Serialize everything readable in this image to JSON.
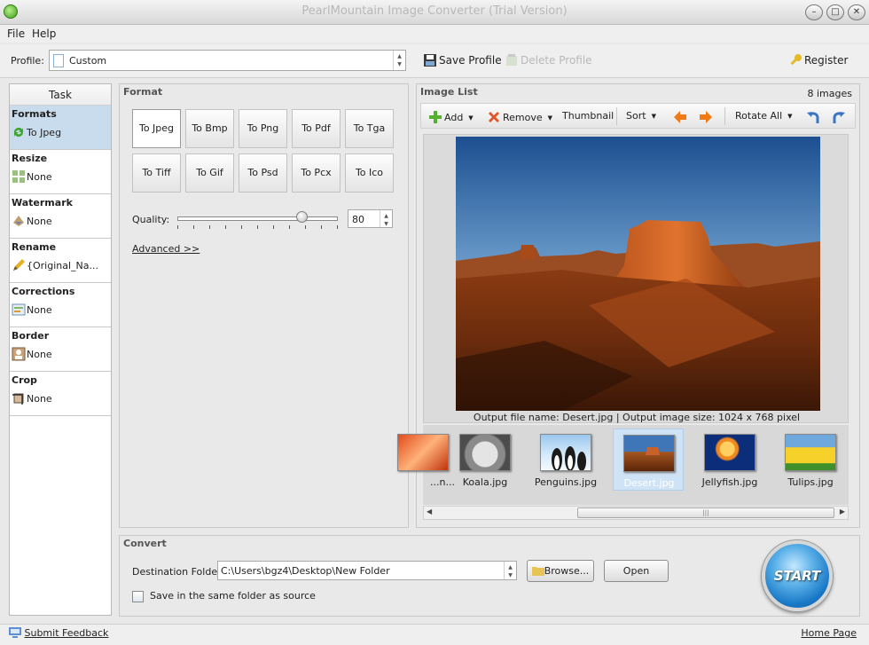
{
  "window": {
    "title": "PearlMountain Image Converter (Trial Version)",
    "controls": [
      "minimize",
      "maximize",
      "close"
    ]
  },
  "menu": {
    "items": [
      {
        "label": "File"
      },
      {
        "label": "Help"
      }
    ]
  },
  "toolbar": {
    "profile_label": "Profile:",
    "profile_value": "Custom",
    "save_profile": "Save Profile",
    "delete_profile": "Delete Profile",
    "register": "Register"
  },
  "task_panel": {
    "header": "Task",
    "items": [
      {
        "name": "Formats",
        "value": "To Jpeg",
        "icon": "convert-icon"
      },
      {
        "name": "Resize",
        "value": "None",
        "icon": "resize-icon"
      },
      {
        "name": "Watermark",
        "value": "None",
        "icon": "watermark-icon"
      },
      {
        "name": "Rename",
        "value": "{Original_Na...",
        "icon": "pencil-icon"
      },
      {
        "name": "Corrections",
        "value": "None",
        "icon": "corrections-icon"
      },
      {
        "name": "Border",
        "value": "None",
        "icon": "border-icon"
      },
      {
        "name": "Crop",
        "value": "None",
        "icon": "crop-icon"
      }
    ]
  },
  "format_panel": {
    "title": "Format",
    "buttons": [
      "To Jpeg",
      "To Bmp",
      "To Png",
      "To Pdf",
      "To Tga",
      "To Tiff",
      "To Gif",
      "To Psd",
      "To Pcx",
      "To Ico"
    ],
    "selected": "To Jpeg",
    "quality_label": "Quality:",
    "quality_value": "80",
    "advanced_link": "Advanced >>"
  },
  "image_list": {
    "title": "Image List",
    "count": "8 images",
    "toolbar": {
      "add": "Add",
      "remove": "Remove",
      "thumbnail": "Thumbnail",
      "sort": "Sort",
      "rotate_all": "Rotate All"
    },
    "caption": "Output file name: Desert.jpg | Output image size: 1024 x 768 pixel",
    "thumbnails": [
      {
        "label": "...n..."
      },
      {
        "label": "Koala.jpg"
      },
      {
        "label": "Penguins.jpg"
      },
      {
        "label": "Desert.jpg"
      },
      {
        "label": "Jellyfish.jpg"
      },
      {
        "label": "Tulips.jpg"
      }
    ],
    "selected_thumbnail": "Desert.jpg"
  },
  "convert_panel": {
    "title": "Convert",
    "dest_label": "Destination Folder:",
    "dest_value": "C:\\Users\\bgz4\\Desktop\\New Folder",
    "browse": "Browse...",
    "open": "Open",
    "same_folder_label": "Save in the same folder as source",
    "same_folder_checked": false,
    "start": "START"
  },
  "statusbar": {
    "feedback": "Submit Feedback",
    "home": "Home Page"
  },
  "colors": {
    "selection_blue": "#c9dced",
    "start_blue": "#1978c6"
  }
}
